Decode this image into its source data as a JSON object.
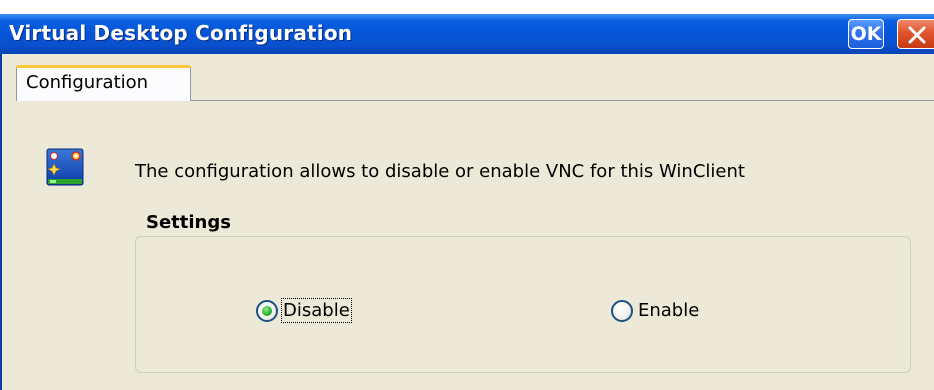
{
  "window": {
    "title": "Virtual Desktop Configuration",
    "ok_label": "OK"
  },
  "tabs": [
    {
      "label": "Configuration",
      "selected": true
    }
  ],
  "content": {
    "description": "The configuration allows to disable or enable VNC for this WinClient",
    "icon": "desktop-app-icon"
  },
  "settings": {
    "legend": "Settings",
    "options": [
      {
        "label": "Disable",
        "checked": true
      },
      {
        "label": "Enable",
        "checked": false
      }
    ]
  },
  "colors": {
    "titlebar": "#0554d8",
    "window_bg": "#ece9d8",
    "radio_selected": "#2fb02f",
    "close_button": "#e0542e"
  }
}
